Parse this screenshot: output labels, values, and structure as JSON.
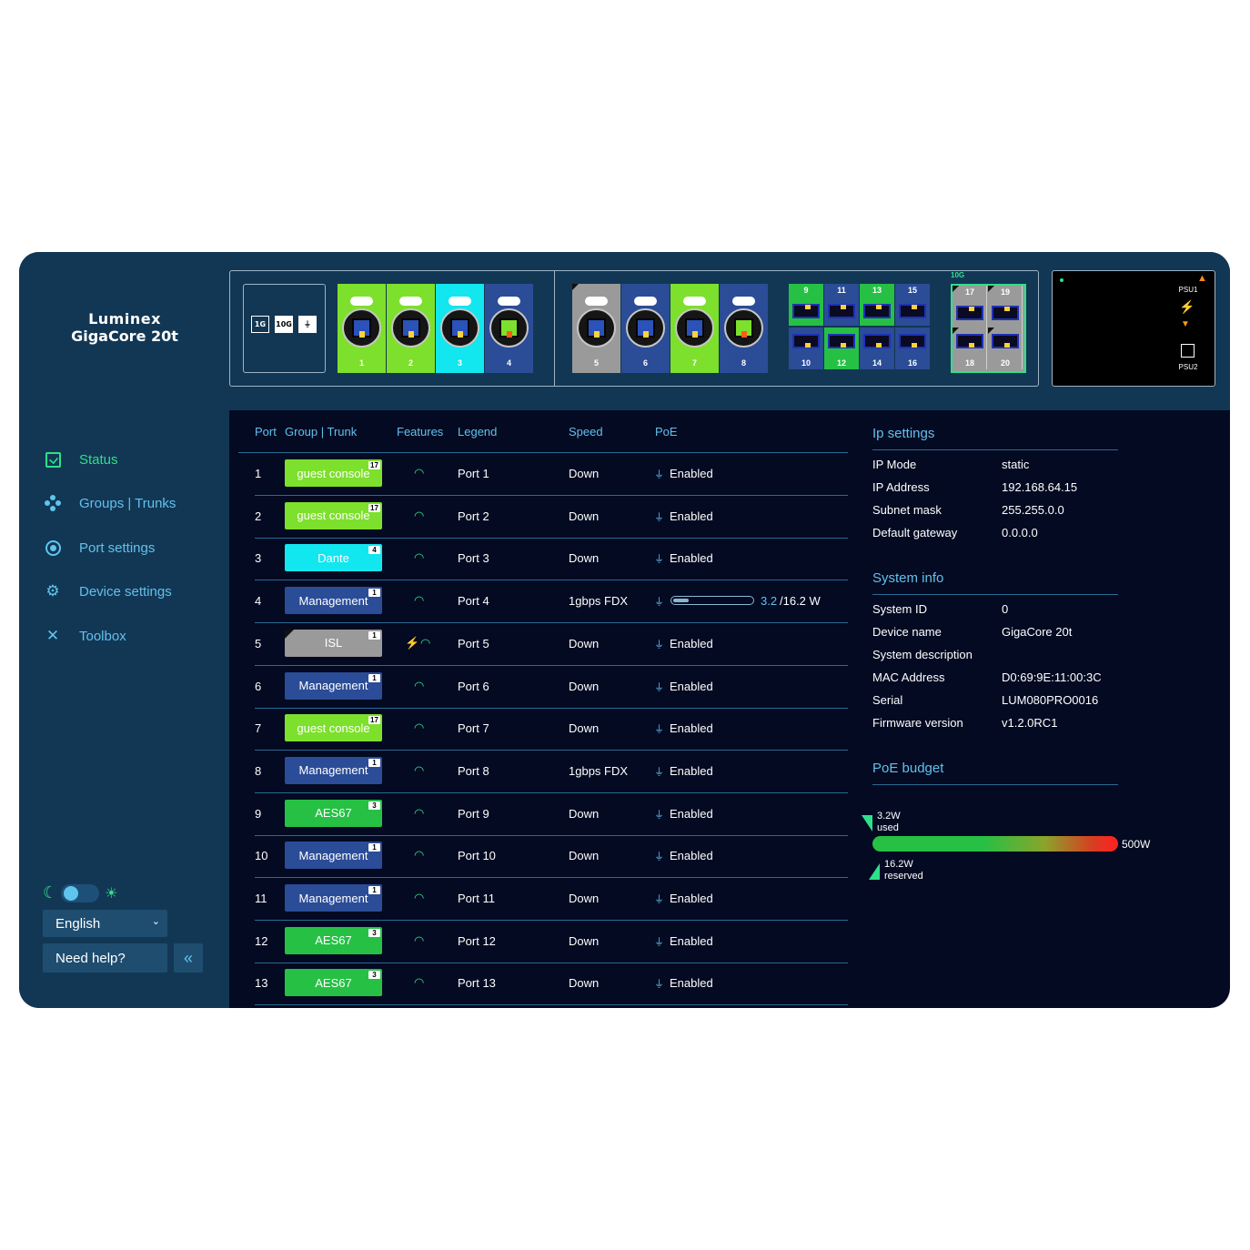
{
  "brand": {
    "line1": "Luminex",
    "line2": "GigaCore 20t"
  },
  "front_panel": {
    "mode_icons": [
      "1G",
      "10G",
      "PoE"
    ],
    "rj45_ports": [
      {
        "num": "1",
        "color": "#7de02c",
        "lit": false
      },
      {
        "num": "2",
        "color": "#7de02c",
        "lit": false
      },
      {
        "num": "3",
        "color": "#12e6ef",
        "lit": false
      },
      {
        "num": "4",
        "color": "#2b4c97",
        "lit": true
      },
      {
        "num": "5",
        "color": "#9a9a9a",
        "lit": false
      },
      {
        "num": "6",
        "color": "#2b4c97",
        "lit": false
      },
      {
        "num": "7",
        "color": "#7de02c",
        "lit": false
      },
      {
        "num": "8",
        "color": "#2b4c97",
        "lit": true
      }
    ],
    "sfp_ports": [
      {
        "num": "9",
        "color": "#26c045"
      },
      {
        "num": "10",
        "color": "#2b4c97"
      },
      {
        "num": "11",
        "color": "#2b4c97"
      },
      {
        "num": "12",
        "color": "#26c045"
      },
      {
        "num": "13",
        "color": "#26c045"
      },
      {
        "num": "14",
        "color": "#2b4c97"
      },
      {
        "num": "15",
        "color": "#2b4c97"
      },
      {
        "num": "16",
        "color": "#2b4c97"
      }
    ],
    "sfp10g_label": "10G",
    "sfp10g_ports": [
      "17",
      "18",
      "19",
      "20"
    ],
    "psu1_label": "PSU1",
    "psu2_label": "PSU2"
  },
  "nav": {
    "status": "Status",
    "groups": "Groups | Trunks",
    "port_settings": "Port settings",
    "device_settings": "Device settings",
    "toolbox": "Toolbox"
  },
  "language": "English",
  "help": "Need help?",
  "table": {
    "headers": {
      "port": "Port",
      "group": "Group | Trunk",
      "features": "Features",
      "legend": "Legend",
      "speed": "Speed",
      "poe": "PoE"
    },
    "rows": [
      {
        "port": "1",
        "group": "guest console",
        "count": "17",
        "color": "#7de02c",
        "legend": "Port 1",
        "speed": "Down",
        "poe": "Enabled"
      },
      {
        "port": "2",
        "group": "guest console",
        "count": "17",
        "color": "#7de02c",
        "legend": "Port 2",
        "speed": "Down",
        "poe": "Enabled"
      },
      {
        "port": "3",
        "group": "Dante",
        "count": "4",
        "color": "#12e6ef",
        "legend": "Port 3",
        "speed": "Down",
        "poe": "Enabled"
      },
      {
        "port": "4",
        "group": "Management",
        "count": "1",
        "color": "#2b4c97",
        "legend": "Port 4",
        "speed": "1gbps FDX",
        "poe": "",
        "poe_used": "3.2",
        "poe_max": "/16.2 W",
        "poe_fraction": 0.2
      },
      {
        "port": "5",
        "group": "ISL",
        "count": "1",
        "color": "#9a9a9a",
        "legend": "Port 5",
        "speed": "Down",
        "poe": "Enabled",
        "isl": true
      },
      {
        "port": "6",
        "group": "Management",
        "count": "1",
        "color": "#2b4c97",
        "legend": "Port 6",
        "speed": "Down",
        "poe": "Enabled"
      },
      {
        "port": "7",
        "group": "guest console",
        "count": "17",
        "color": "#7de02c",
        "legend": "Port 7",
        "speed": "Down",
        "poe": "Enabled"
      },
      {
        "port": "8",
        "group": "Management",
        "count": "1",
        "color": "#2b4c97",
        "legend": "Port 8",
        "speed": "1gbps FDX",
        "poe": "Enabled"
      },
      {
        "port": "9",
        "group": "AES67",
        "count": "3",
        "color": "#26c045",
        "legend": "Port 9",
        "speed": "Down",
        "poe": "Enabled"
      },
      {
        "port": "10",
        "group": "Management",
        "count": "1",
        "color": "#2b4c97",
        "legend": "Port 10",
        "speed": "Down",
        "poe": "Enabled"
      },
      {
        "port": "11",
        "group": "Management",
        "count": "1",
        "color": "#2b4c97",
        "legend": "Port 11",
        "speed": "Down",
        "poe": "Enabled"
      },
      {
        "port": "12",
        "group": "AES67",
        "count": "3",
        "color": "#26c045",
        "legend": "Port 12",
        "speed": "Down",
        "poe": "Enabled"
      },
      {
        "port": "13",
        "group": "AES67",
        "count": "3",
        "color": "#26c045",
        "legend": "Port 13",
        "speed": "Down",
        "poe": "Enabled"
      }
    ]
  },
  "ip_settings": {
    "title": "Ip settings",
    "items": [
      {
        "label": "IP Mode",
        "value": "static"
      },
      {
        "label": "IP Address",
        "value": "192.168.64.15"
      },
      {
        "label": "Subnet mask",
        "value": "255.255.0.0"
      },
      {
        "label": "Default gateway",
        "value": "0.0.0.0"
      }
    ]
  },
  "system_info": {
    "title": "System info",
    "items": [
      {
        "label": "System ID",
        "value": "0"
      },
      {
        "label": "Device name",
        "value": "GigaCore 20t"
      },
      {
        "label": "System description",
        "value": ""
      },
      {
        "label": "MAC Address",
        "value": "D0:69:9E:11:00:3C"
      },
      {
        "label": "Serial",
        "value": "LUM080PRO0016"
      },
      {
        "label": "Firmware version",
        "value": "v1.2.0RC1"
      }
    ]
  },
  "poe_budget": {
    "title": "PoE budget",
    "used": "3.2W",
    "used_label": "used",
    "reserved": "16.2W",
    "reserved_label": "reserved",
    "total": "500W"
  }
}
